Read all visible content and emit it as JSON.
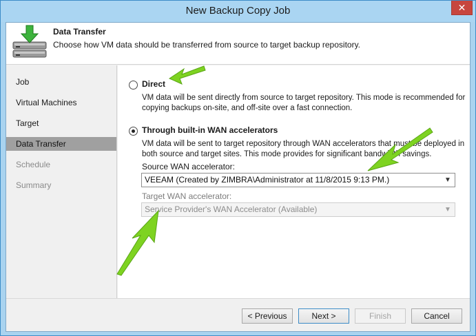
{
  "window": {
    "title": "New Backup Copy Job",
    "close_glyph": "✕"
  },
  "header": {
    "title": "Data Transfer",
    "description": "Choose how VM data should be transferred from source to target backup repository.",
    "icon": "server-download-icon"
  },
  "sidebar": {
    "items": [
      {
        "label": "Job",
        "state": "normal"
      },
      {
        "label": "Virtual Machines",
        "state": "normal"
      },
      {
        "label": "Target",
        "state": "normal"
      },
      {
        "label": "Data Transfer",
        "state": "active"
      },
      {
        "label": "Schedule",
        "state": "disabled"
      },
      {
        "label": "Summary",
        "state": "disabled"
      }
    ]
  },
  "options": {
    "direct": {
      "label": "Direct",
      "selected": false,
      "description_line1": "VM data will be sent directly from source to target repository. This mode is recommended for",
      "description_line2": "copying backups on-site, and off-site over a fast connection."
    },
    "wan": {
      "label": "Through built-in WAN accelerators",
      "selected": true,
      "description_line1": "VM data will be sent to target repository through WAN accelerators that must be deployed in",
      "description_line2": "both source and target sites. This mode provides for significant bandwidth savings."
    }
  },
  "source_wan": {
    "label": "Source WAN accelerator:",
    "value": "VEEAM (Created by ZIMBRA\\Administrator at 11/8/2015 9:13 PM.)"
  },
  "target_wan": {
    "label": "Target WAN accelerator:",
    "value": "Service Provider's WAN Accelerator (Available)",
    "enabled": false
  },
  "buttons": {
    "previous": "< Previous",
    "next": "Next >",
    "finish": "Finish",
    "cancel": "Cancel"
  },
  "colors": {
    "title_bar": "#aad5f2",
    "close_button": "#c7463e",
    "active_nav": "#a0a0a0",
    "annotation_arrow": "#7ed321"
  }
}
